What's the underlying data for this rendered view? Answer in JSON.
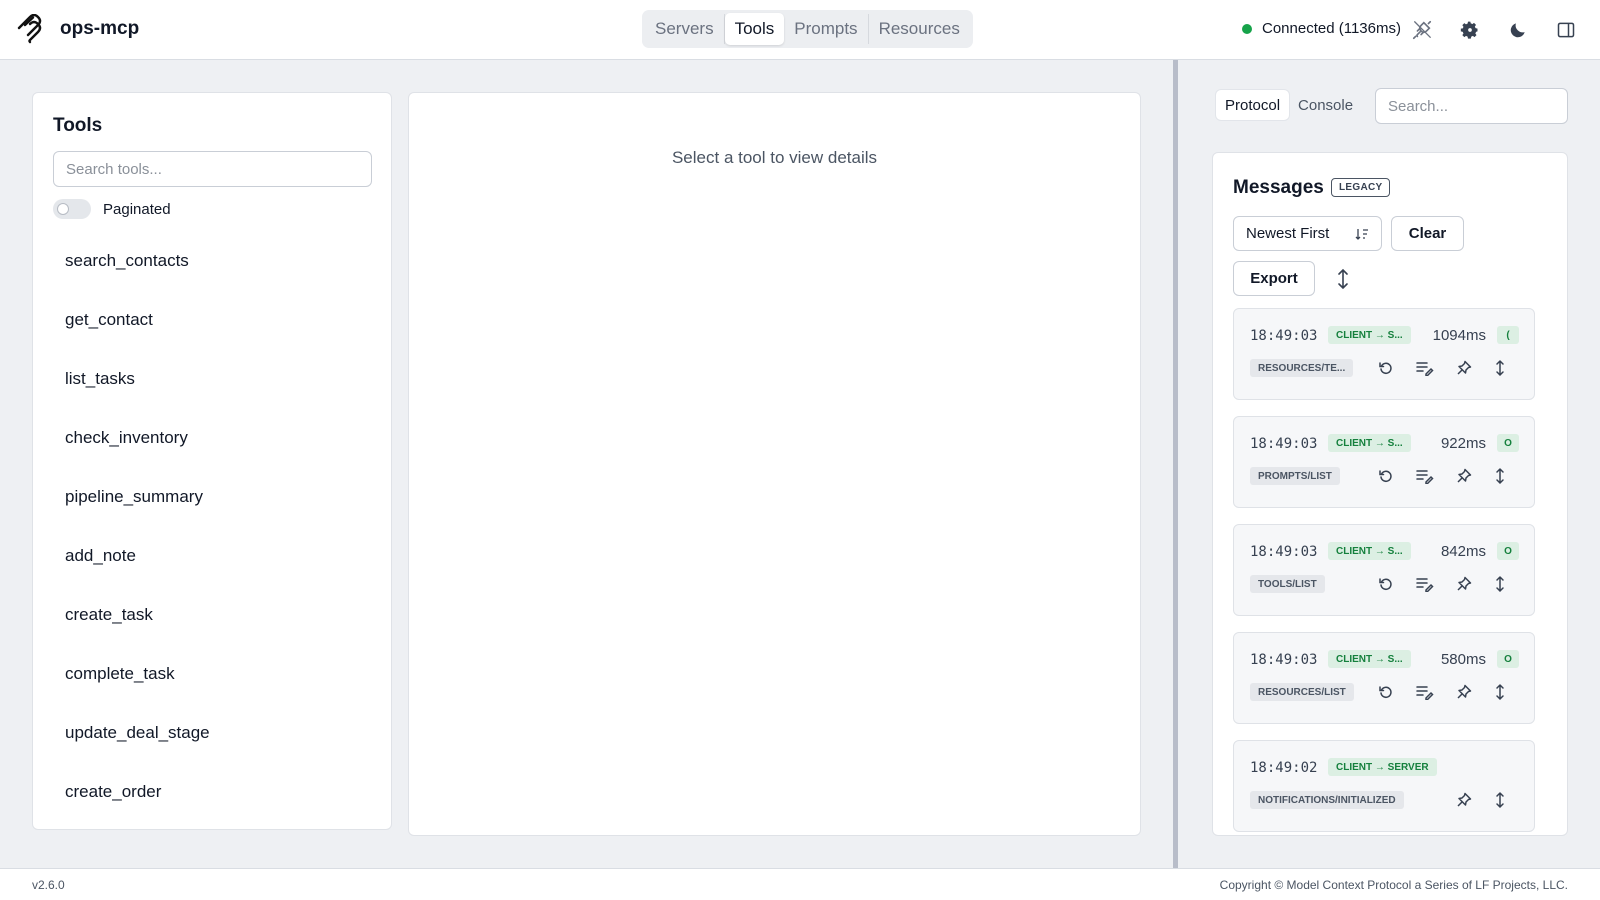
{
  "app": {
    "title": "ops-mcp"
  },
  "nav": {
    "tabs": [
      "Servers",
      "Tools",
      "Prompts",
      "Resources"
    ],
    "active": "Tools"
  },
  "status": {
    "text": "Connected (1136ms)",
    "color": "#16a34a"
  },
  "header_icons": [
    "plug-icon",
    "gear-icon",
    "moon-icon",
    "panel-toggle-icon"
  ],
  "tools_panel": {
    "title": "Tools",
    "search_placeholder": "Search tools...",
    "paginated_label": "Paginated",
    "paginated_on": false,
    "tools": [
      "search_contacts",
      "get_contact",
      "list_tasks",
      "check_inventory",
      "pipeline_summary",
      "add_note",
      "create_task",
      "complete_task",
      "update_deal_stage",
      "create_order"
    ]
  },
  "details": {
    "empty_text": "Select a tool to view details"
  },
  "right_panel": {
    "tabs": [
      "Protocol",
      "Console"
    ],
    "active_tab": "Protocol",
    "search_placeholder": "Search...",
    "messages_title": "Messages",
    "legacy_badge": "LEGACY",
    "sort_value": "Newest First",
    "clear_label": "Clear",
    "export_label": "Export",
    "messages": [
      {
        "time": "18:49:03",
        "direction": "CLIENT → S...",
        "duration": "1094ms",
        "code": "(",
        "method": "RESOURCES/TE...",
        "replay": true
      },
      {
        "time": "18:49:03",
        "direction": "CLIENT → S...",
        "duration": "922ms",
        "code": "O",
        "method": "PROMPTS/LIST",
        "replay": true
      },
      {
        "time": "18:49:03",
        "direction": "CLIENT → S...",
        "duration": "842ms",
        "code": "O",
        "method": "TOOLS/LIST",
        "replay": true
      },
      {
        "time": "18:49:03",
        "direction": "CLIENT → S...",
        "duration": "580ms",
        "code": "O",
        "method": "RESOURCES/LIST",
        "replay": true
      },
      {
        "time": "18:49:02",
        "direction": "CLIENT → SERVER",
        "duration": "",
        "code": "",
        "method": "NOTIFICATIONS/INITIALIZED",
        "replay": false
      }
    ]
  },
  "footer": {
    "version": "v2.6.0",
    "copyright": "Copyright © Model Context Protocol a Series of LF Projects, LLC."
  }
}
